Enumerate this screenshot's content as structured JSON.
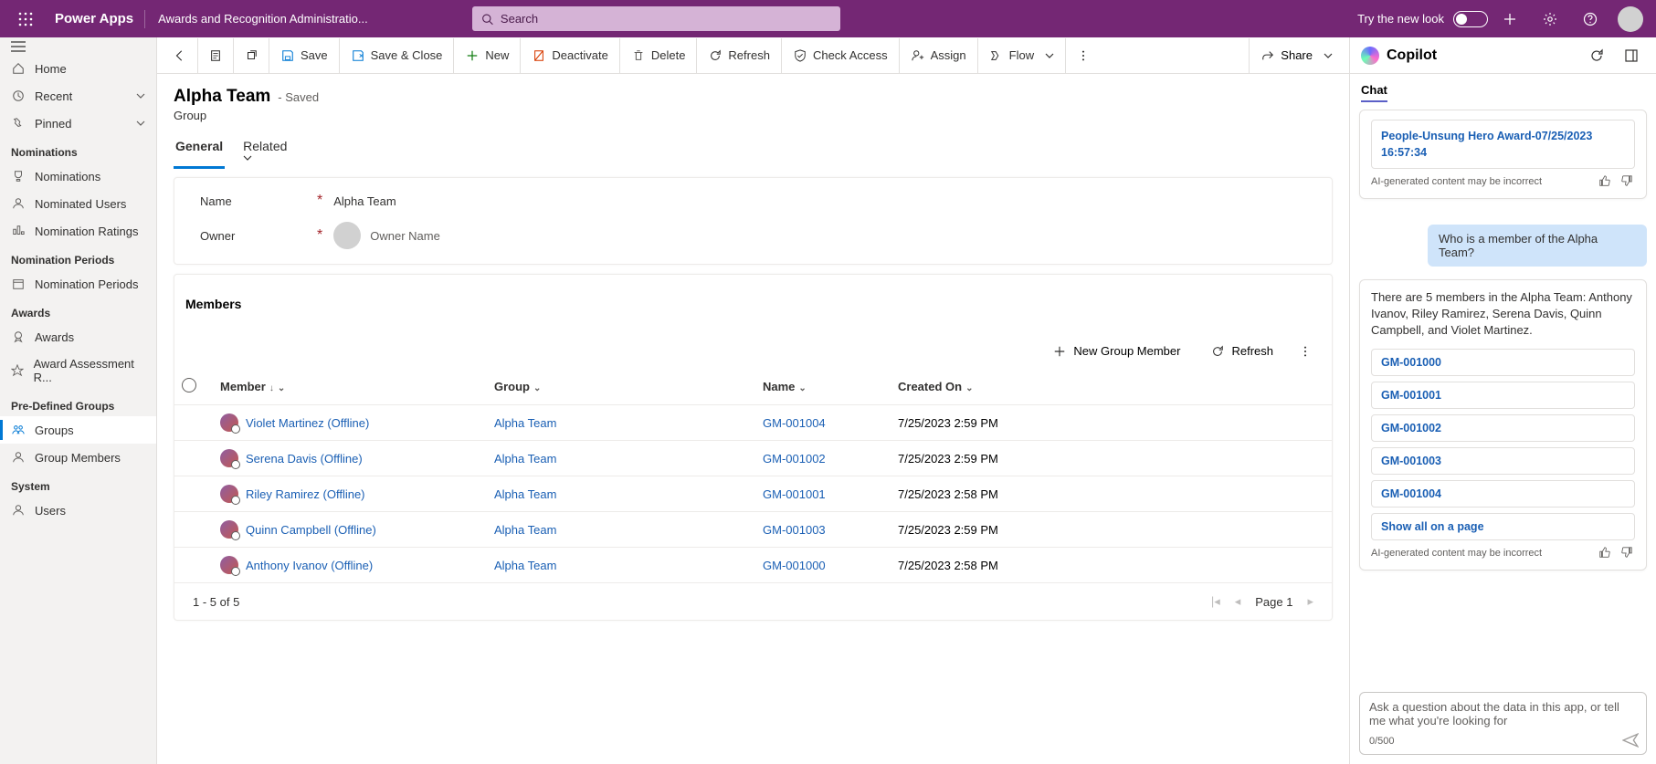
{
  "topbar": {
    "brand": "Power Apps",
    "app_name": "Awards and Recognition Administratio...",
    "search_placeholder": "Search",
    "try_look": "Try the new look"
  },
  "sidebar": {
    "home": "Home",
    "recent": "Recent",
    "pinned": "Pinned",
    "sections": [
      {
        "title": "Nominations",
        "items": [
          "Nominations",
          "Nominated Users",
          "Nomination Ratings"
        ]
      },
      {
        "title": "Nomination Periods",
        "items": [
          "Nomination Periods"
        ]
      },
      {
        "title": "Awards",
        "items": [
          "Awards",
          "Award Assessment R..."
        ]
      },
      {
        "title": "Pre-Defined Groups",
        "items": [
          "Groups",
          "Group Members"
        ]
      },
      {
        "title": "System",
        "items": [
          "Users"
        ]
      }
    ]
  },
  "cmd": {
    "save": "Save",
    "save_close": "Save & Close",
    "new": "New",
    "deactivate": "Deactivate",
    "delete": "Delete",
    "refresh": "Refresh",
    "check_access": "Check Access",
    "assign": "Assign",
    "flow": "Flow",
    "share": "Share"
  },
  "record": {
    "title": "Alpha Team",
    "saved": "- Saved",
    "entity": "Group",
    "tabs": {
      "general": "General",
      "related": "Related"
    },
    "fields": {
      "name_label": "Name",
      "name_value": "Alpha Team",
      "owner_label": "Owner",
      "owner_value": "Owner Name"
    }
  },
  "members": {
    "section_title": "Members",
    "new_btn": "New Group Member",
    "refresh_btn": "Refresh",
    "columns": {
      "member": "Member",
      "group": "Group",
      "name": "Name",
      "created": "Created On"
    },
    "rows": [
      {
        "member": "Violet Martinez (Offline)",
        "group": "Alpha Team",
        "name": "GM-001004",
        "created": "7/25/2023 2:59 PM"
      },
      {
        "member": "Serena Davis (Offline)",
        "group": "Alpha Team",
        "name": "GM-001002",
        "created": "7/25/2023 2:59 PM"
      },
      {
        "member": "Riley Ramirez (Offline)",
        "group": "Alpha Team",
        "name": "GM-001001",
        "created": "7/25/2023 2:58 PM"
      },
      {
        "member": "Quinn Campbell (Offline)",
        "group": "Alpha Team",
        "name": "GM-001003",
        "created": "7/25/2023 2:59 PM"
      },
      {
        "member": "Anthony Ivanov (Offline)",
        "group": "Alpha Team",
        "name": "GM-001000",
        "created": "7/25/2023 2:58 PM"
      }
    ],
    "paging": {
      "summary": "1 - 5 of 5",
      "page": "Page 1"
    }
  },
  "copilot": {
    "title": "Copilot",
    "tab": "Chat",
    "prior_link": "People-Unsung Hero Award-07/25/2023 16:57:34",
    "ai_note": "AI-generated content may be incorrect",
    "user_msg": "Who is a member of the Alpha Team?",
    "answer": "There are 5 members in the Alpha Team: Anthony Ivanov, Riley Ramirez, Serena Davis, Quinn Campbell, and Violet Martinez.",
    "refs": [
      "GM-001000",
      "GM-001001",
      "GM-001002",
      "GM-001003",
      "GM-001004"
    ],
    "show_all": "Show all on a page",
    "input_placeholder": "Ask a question about the data in this app, or tell me what you're looking for",
    "char_count": "0/500"
  }
}
